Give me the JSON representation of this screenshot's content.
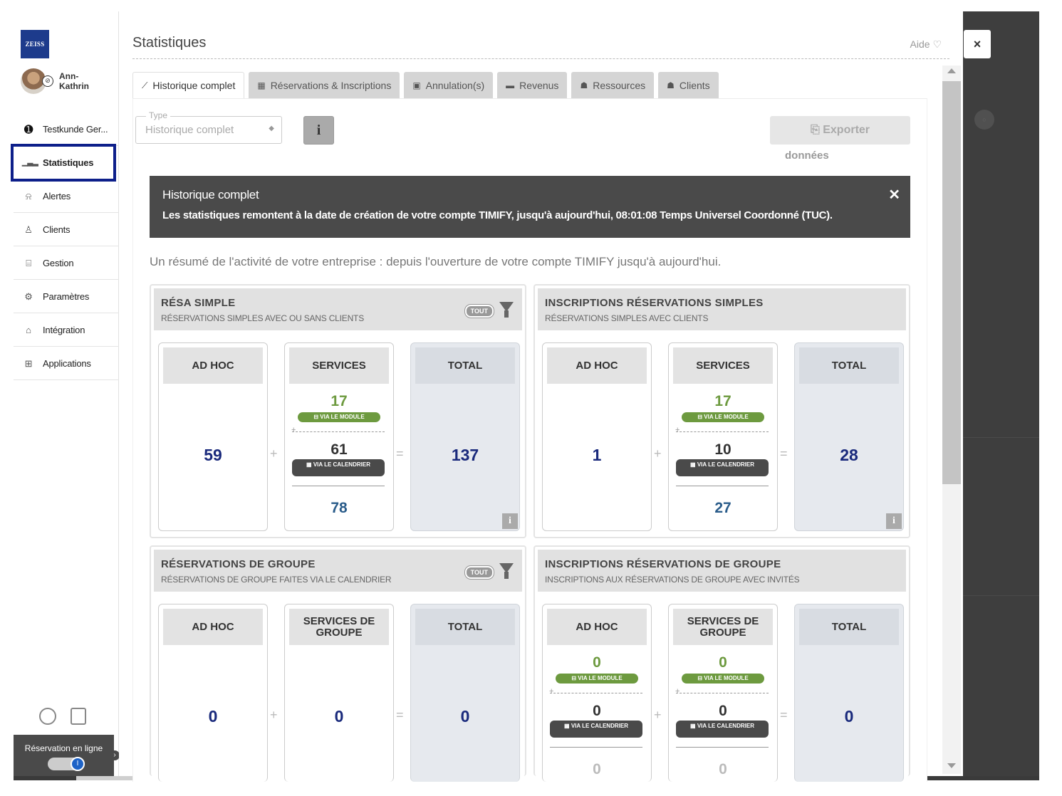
{
  "sidebar": {
    "logo": "ZEISS",
    "user_name": "Ann-\nKathrin",
    "items": [
      {
        "label": "Testkunde Ger...",
        "icon": "account-switch-icon"
      },
      {
        "label": "Statistiques",
        "icon": "bar-chart-icon"
      },
      {
        "label": "Alertes",
        "icon": "bell-icon"
      },
      {
        "label": "Clients",
        "icon": "user-icon"
      },
      {
        "label": "Gestion",
        "icon": "briefcase-icon"
      },
      {
        "label": "Paramètres",
        "icon": "gears-icon"
      },
      {
        "label": "Intégration",
        "icon": "plugin-icon"
      },
      {
        "label": "Applications",
        "icon": "grid-icon"
      }
    ],
    "booking_label": "Réservation en ligne",
    "toggle_state": "I"
  },
  "page": {
    "title": "Statistiques",
    "aide": "Aide"
  },
  "tabs": [
    {
      "label": "Historique complet",
      "icon": "line-chart-icon"
    },
    {
      "label": "Réservations & Inscriptions",
      "icon": "calendar-icon"
    },
    {
      "label": "Annulation(s)",
      "icon": "calendar-x-icon"
    },
    {
      "label": "Revenus",
      "icon": "money-icon"
    },
    {
      "label": "Ressources",
      "icon": "users-icon"
    },
    {
      "label": "Clients",
      "icon": "user-icon"
    }
  ],
  "filters": {
    "type_label": "Type",
    "type_value": "Historique complet",
    "info": "i",
    "export_label": "Exporter",
    "export_sub": "données"
  },
  "alert": {
    "title": "Historique complet",
    "text": "Les statistiques remontent à la date de création de votre compte TIMIFY, jusqu'à aujourd'hui, 08:01:08 Temps Universel Coordonné (TUC).",
    "close": "✕"
  },
  "summary": "Un résumé de l'activité de votre entreprise : depuis l'ouverture de votre compte TIMIFY jusqu'à aujourd'hui.",
  "labels": {
    "ad_hoc": "AD HOC",
    "services": "SERVICES",
    "services_groupe": "SERVICES DE GROUPE",
    "total": "TOTAL",
    "via_module": "VIA LE MODULE",
    "via_cal": "VIA LE CALENDRIER",
    "tout": "TOUT",
    "plus": "+",
    "equals": "=",
    "i": "i"
  },
  "cards": {
    "resa_simple": {
      "title": "RÉSA SIMPLE",
      "subtitle": "RÉSERVATIONS SIMPLES AVEC OU SANS CLIENTS",
      "ad_hoc": "59",
      "via_module": "17",
      "via_cal": "61",
      "services_total": "78",
      "total": "137"
    },
    "inscr_simple": {
      "title": "INSCRIPTIONS RÉSERVATIONS SIMPLES",
      "subtitle": "RÉSERVATIONS SIMPLES AVEC CLIENTS",
      "ad_hoc": "1",
      "via_module": "17",
      "via_cal": "10",
      "services_total": "27",
      "total": "28"
    },
    "resa_groupe": {
      "title": "RÉSERVATIONS DE GROUPE",
      "subtitle": "RÉSERVATIONS DE GROUPE FAITES VIA LE CALENDRIER",
      "ad_hoc": "0",
      "services": "0",
      "total": "0"
    },
    "inscr_groupe": {
      "title": "INSCRIPTIONS RÉSERVATIONS DE GROUPE",
      "subtitle": "INSCRIPTIONS AUX RÉSERVATIONS DE GROUPE AVEC INVITÉS",
      "adhoc_module": "0",
      "adhoc_cal": "0",
      "adhoc_total": "0",
      "svc_module": "0",
      "svc_cal": "0",
      "svc_total": "0",
      "total": "0"
    }
  },
  "close": "×"
}
